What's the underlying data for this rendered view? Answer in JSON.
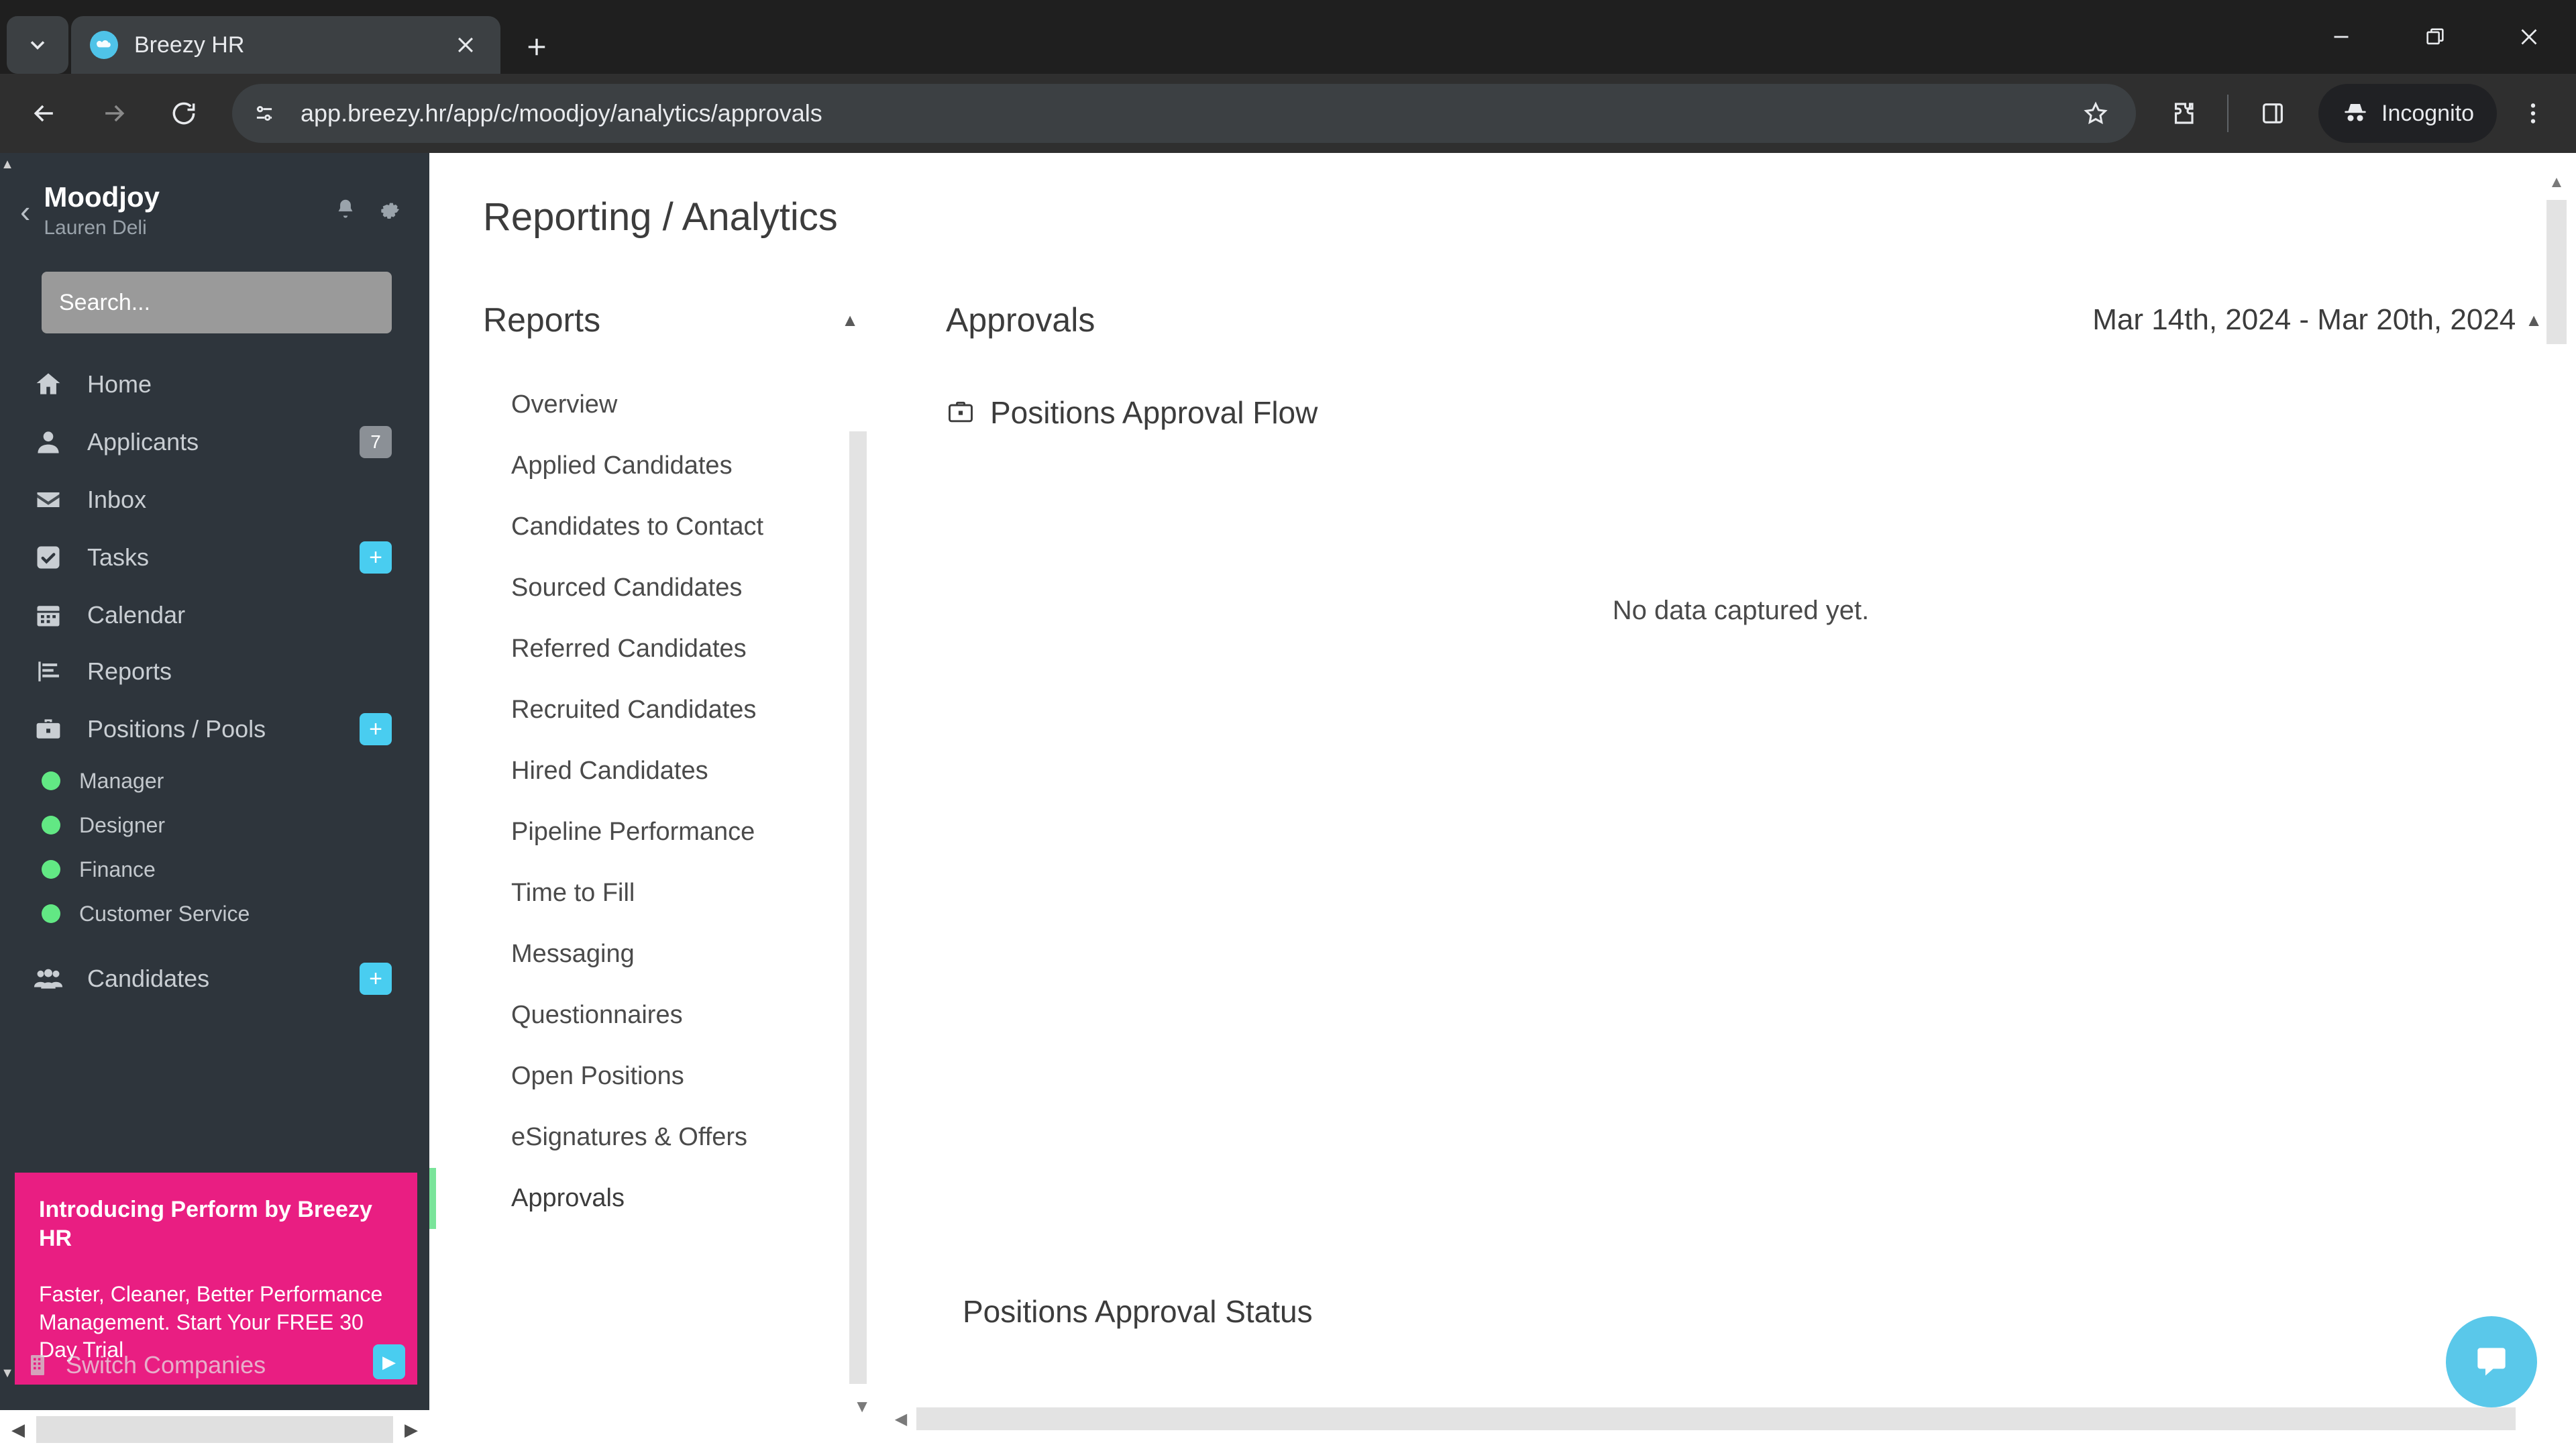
{
  "browser": {
    "tab": {
      "title": "Breezy HR",
      "favicon_icon": "breezy-cloud-icon",
      "close_icon": "close-icon"
    },
    "tab_list_icon": "chevron-down-icon",
    "new_tab_icon": "plus-icon",
    "window": {
      "minimize": "minimize-icon",
      "maximize": "maximize-icon",
      "close": "close-icon"
    },
    "nav": {
      "back": "back-arrow-icon",
      "forward": "forward-arrow-icon",
      "reload": "reload-icon"
    },
    "omnibox": {
      "url": "app.breezy.hr/app/c/moodjoy/analytics/approvals",
      "site_settings_icon": "tune-icon",
      "bookmark_icon": "star-icon"
    },
    "toolbar": {
      "extensions_icon": "extensions-puzzle-icon",
      "side_panel_icon": "side-panel-icon",
      "incognito_label": "Incognito",
      "incognito_icon": "incognito-hat-icon",
      "menu_icon": "three-dot-menu-icon"
    }
  },
  "sidebar": {
    "back_icon": "chevron-left-icon",
    "company": "Moodjoy",
    "user": "Lauren Deli",
    "bell_icon": "bell-icon",
    "gear_icon": "gear-icon",
    "search_placeholder": "Search...",
    "items": [
      {
        "label": "Home",
        "icon": "home-icon",
        "badge": null,
        "badge_type": null
      },
      {
        "label": "Applicants",
        "icon": "person-icon",
        "badge": "7",
        "badge_type": "count"
      },
      {
        "label": "Inbox",
        "icon": "envelope-icon",
        "badge": null,
        "badge_type": null
      },
      {
        "label": "Tasks",
        "icon": "checkbox-icon",
        "badge": "+",
        "badge_type": "plus"
      },
      {
        "label": "Calendar",
        "icon": "calendar-icon",
        "badge": null,
        "badge_type": null
      },
      {
        "label": "Reports",
        "icon": "bar-chart-icon",
        "badge": null,
        "badge_type": null
      },
      {
        "label": "Positions / Pools",
        "icon": "briefcase-icon",
        "badge": "+",
        "badge_type": "plus"
      }
    ],
    "positions": [
      {
        "label": "Manager",
        "status_color": "#62e884"
      },
      {
        "label": "Designer",
        "status_color": "#62e884"
      },
      {
        "label": "Finance",
        "status_color": "#62e884"
      },
      {
        "label": "Customer Service",
        "status_color": "#62e884"
      }
    ],
    "candidates": {
      "label": "Candidates",
      "icon": "people-icon",
      "badge": "+"
    },
    "switch_companies": {
      "label": "Switch Companies",
      "icon": "building-icon",
      "arrow": "▶"
    },
    "promo": {
      "title": "Introducing Perform by Breezy HR",
      "body": "Faster, Cleaner, Better Performance Management. Start Your FREE 30 Day Trial"
    },
    "accent_plus_color": "#49cdf0",
    "promo_color": "#e91e82",
    "background_color": "#2e353c"
  },
  "reports_panel": {
    "page_title": "Reporting / Analytics",
    "header": "Reports",
    "collapse_icon": "caret-up-icon",
    "items": [
      "Overview",
      "Applied Candidates",
      "Candidates to Contact",
      "Sourced Candidates",
      "Referred Candidates",
      "Recruited Candidates",
      "Hired Candidates",
      "Pipeline Performance",
      "Time to Fill",
      "Messaging",
      "Questionnaires",
      "Open Positions",
      "eSignatures & Offers",
      "Approvals"
    ],
    "active_item": "Approvals",
    "active_indicator_color": "#7ae49a",
    "scroll_down_icon": "caret-down-icon"
  },
  "main": {
    "header": "Approvals",
    "date_range": "Mar 14th, 2024 - Mar 20th, 2024",
    "date_caret_icon": "caret-up-icon",
    "chart_one": {
      "title": "Positions Approval Flow",
      "icon": "briefcase-icon",
      "empty_message": "No data captured yet."
    },
    "chart_two": {
      "title": "Positions Approval Status"
    },
    "scroll_up_icon": "caret-up-icon",
    "hscroll_left_icon": "caret-left-icon",
    "intercom_icon": "chat-bubble-icon",
    "intercom_color": "#5ac8ea"
  },
  "chart_data": [
    {
      "type": "bar",
      "title": "Positions Approval Flow",
      "categories": [],
      "values": [],
      "annotations": [
        "No data captured yet."
      ],
      "xlabel": "",
      "ylabel": "",
      "grid": false,
      "legend": "none",
      "date_range": "Mar 14th, 2024 - Mar 20th, 2024"
    },
    {
      "type": "bar",
      "title": "Positions Approval Status",
      "categories": [],
      "values": [],
      "annotations": [],
      "xlabel": "",
      "ylabel": "",
      "grid": false,
      "legend": "none",
      "date_range": "Mar 14th, 2024 - Mar 20th, 2024"
    }
  ]
}
